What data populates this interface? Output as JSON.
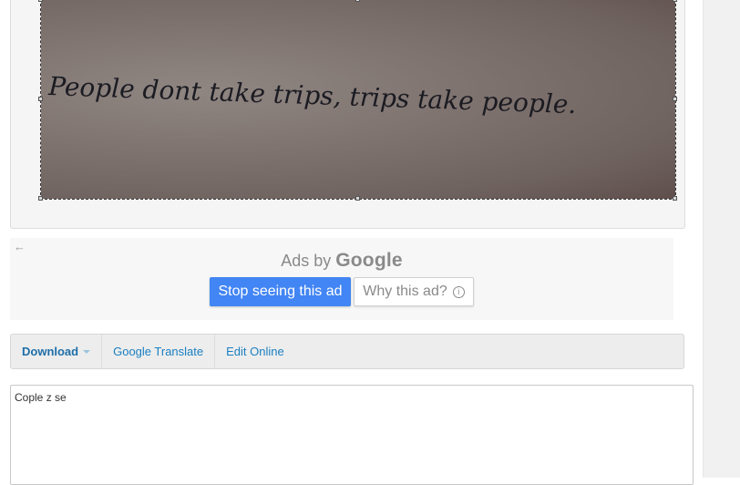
{
  "image": {
    "handwriting_text": "People dont take trips, trips take people."
  },
  "ad": {
    "ads_by": "Ads by",
    "google": "Google",
    "stop_label": "Stop seeing this ad",
    "why_label": "Why this ad?",
    "back_icon": "back-arrow-icon",
    "info_icon": "info-icon"
  },
  "toolbar": {
    "download_label": "Download",
    "translate_label": "Google Translate",
    "edit_label": "Edit Online"
  },
  "result": {
    "value": "Cople z se"
  },
  "colors": {
    "accent_blue": "#4285f4",
    "link_blue": "#1a7fc1"
  }
}
